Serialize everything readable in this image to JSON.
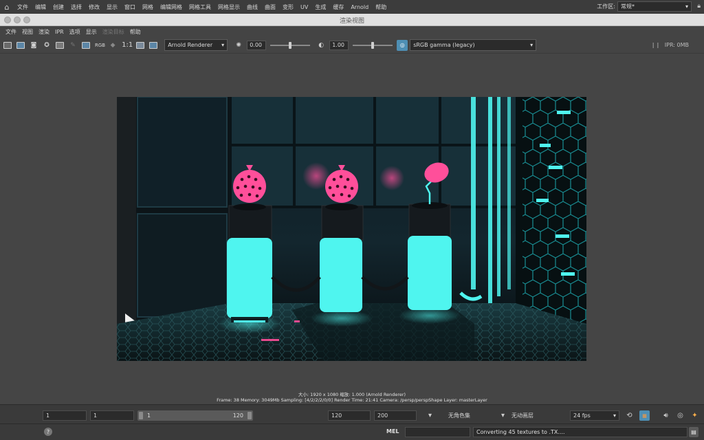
{
  "main_menu": {
    "home_icon": "home-icon",
    "items": [
      "文件",
      "编辑",
      "创建",
      "选择",
      "修改",
      "显示",
      "窗口",
      "网格",
      "编辑网格",
      "网格工具",
      "网格显示",
      "曲线",
      "曲面",
      "变形",
      "UV",
      "生成",
      "缓存",
      "Arnold",
      "帮助"
    ],
    "workspace_label": "工作区:",
    "workspace_value": "常规*",
    "lock_icon": "lock-icon"
  },
  "window": {
    "title": "渲染视图"
  },
  "render_view_menu": {
    "items": [
      "文件",
      "视图",
      "渲染",
      "IPR",
      "选项",
      "显示",
      "渲染目标",
      "帮助"
    ],
    "disabled_index": 6
  },
  "toolbar": {
    "rgb_label": "RGB",
    "ratio_label": "1:1",
    "renderer": "Arnold Renderer",
    "exposure": "0.00",
    "exposure_level": 0.5,
    "gamma": "1.00",
    "gamma_level": 0.5,
    "view_transform": "sRGB gamma (legacy)",
    "ipr_status": "IPR: 0MB"
  },
  "render_info": {
    "line1": "大小: 1920 x 1080  缩放: 1.000     (Arnold Renderer)",
    "line2": "Frame: 38     Memory: 3049Mb     Sampling: [4/2/2/2/0/0]     Render Time: 21:41     Camera: /persp/perspShape     Layer: masterLayer"
  },
  "timeline": {
    "start_value": "1",
    "playback_start": "1",
    "range_start": "1",
    "range_end": "120",
    "playback_end": "120",
    "end_value": "200",
    "character_set": "无角色集",
    "anim_layer": "无动画层",
    "fps": "24 fps"
  },
  "command_line": {
    "mel_label": "MEL",
    "result": "Converting 45 textures to .TX...."
  },
  "colors": {
    "neon_cyan": "#4ff5ef",
    "neon_pink": "#ff4f9a",
    "accent_blue": "#4e8fb4"
  }
}
